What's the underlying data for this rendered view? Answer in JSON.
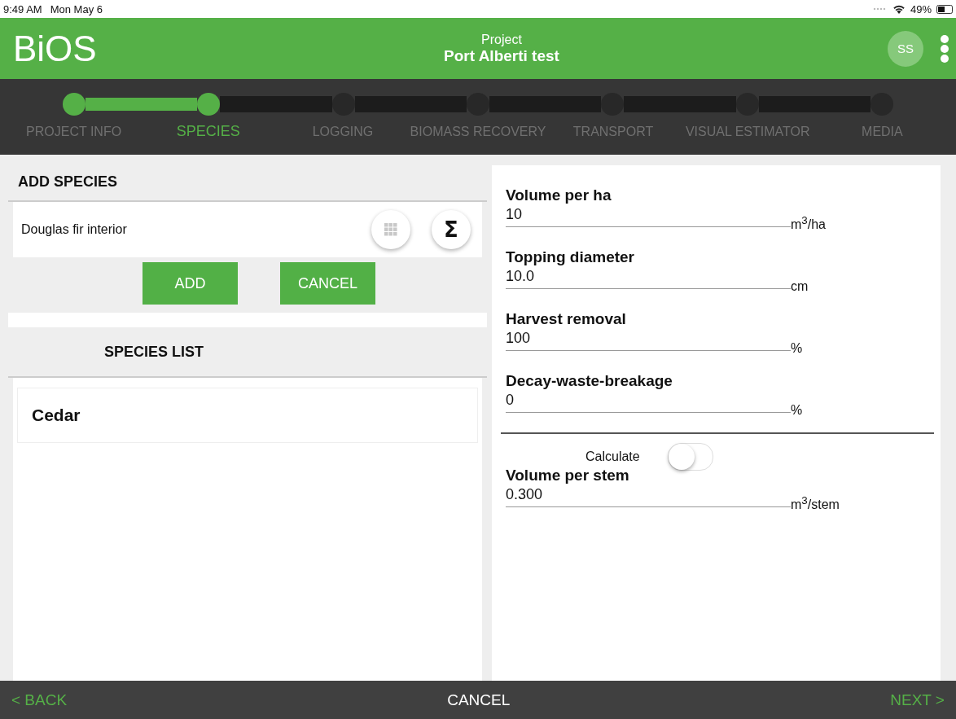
{
  "status_bar": {
    "time": "9:49 AM",
    "date": "Mon May 6",
    "battery": "49%"
  },
  "header": {
    "logo": "BiOS",
    "subtitle": "Project",
    "title": "Port Alberti test",
    "avatar": "SS"
  },
  "steps": [
    {
      "label": "PROJECT INFO",
      "completed": true,
      "selected": false
    },
    {
      "label": "SPECIES",
      "completed": true,
      "selected": true
    },
    {
      "label": "LOGGING",
      "completed": false,
      "selected": false
    },
    {
      "label": "BIOMASS RECOVERY",
      "completed": false,
      "selected": false
    },
    {
      "label": "TRANSPORT",
      "completed": false,
      "selected": false
    },
    {
      "label": "VISUAL ESTIMATOR",
      "completed": false,
      "selected": false
    },
    {
      "label": "MEDIA",
      "completed": false,
      "selected": false
    }
  ],
  "add_species": {
    "title": "ADD SPECIES",
    "species": "Douglas fir interior",
    "sum_button": "Σ",
    "buttons": [
      "ADD",
      "CANCEL"
    ]
  },
  "species_list": {
    "title": "SPECIES LIST",
    "items": [
      "Cedar"
    ]
  },
  "fields": [
    {
      "label": "Volume per ha",
      "value": "10",
      "unit": "m$^{3}$/ha"
    },
    {
      "label": "Topping diameter",
      "value": "10.0",
      "unit": "cm"
    },
    {
      "label": "Harvest removal",
      "value": "100",
      "unit": "%"
    },
    {
      "label": "Decay-waste-breakage",
      "value": "0",
      "unit": "%"
    }
  ],
  "stem": {
    "toggle_label": "Calculate",
    "on": false,
    "label": "Volume per stem",
    "value": "0.300",
    "unit": "m$^{3}$/stem"
  },
  "footer": {
    "back": "< BACK",
    "cancel": "CANCEL",
    "next": "NEXT >"
  }
}
